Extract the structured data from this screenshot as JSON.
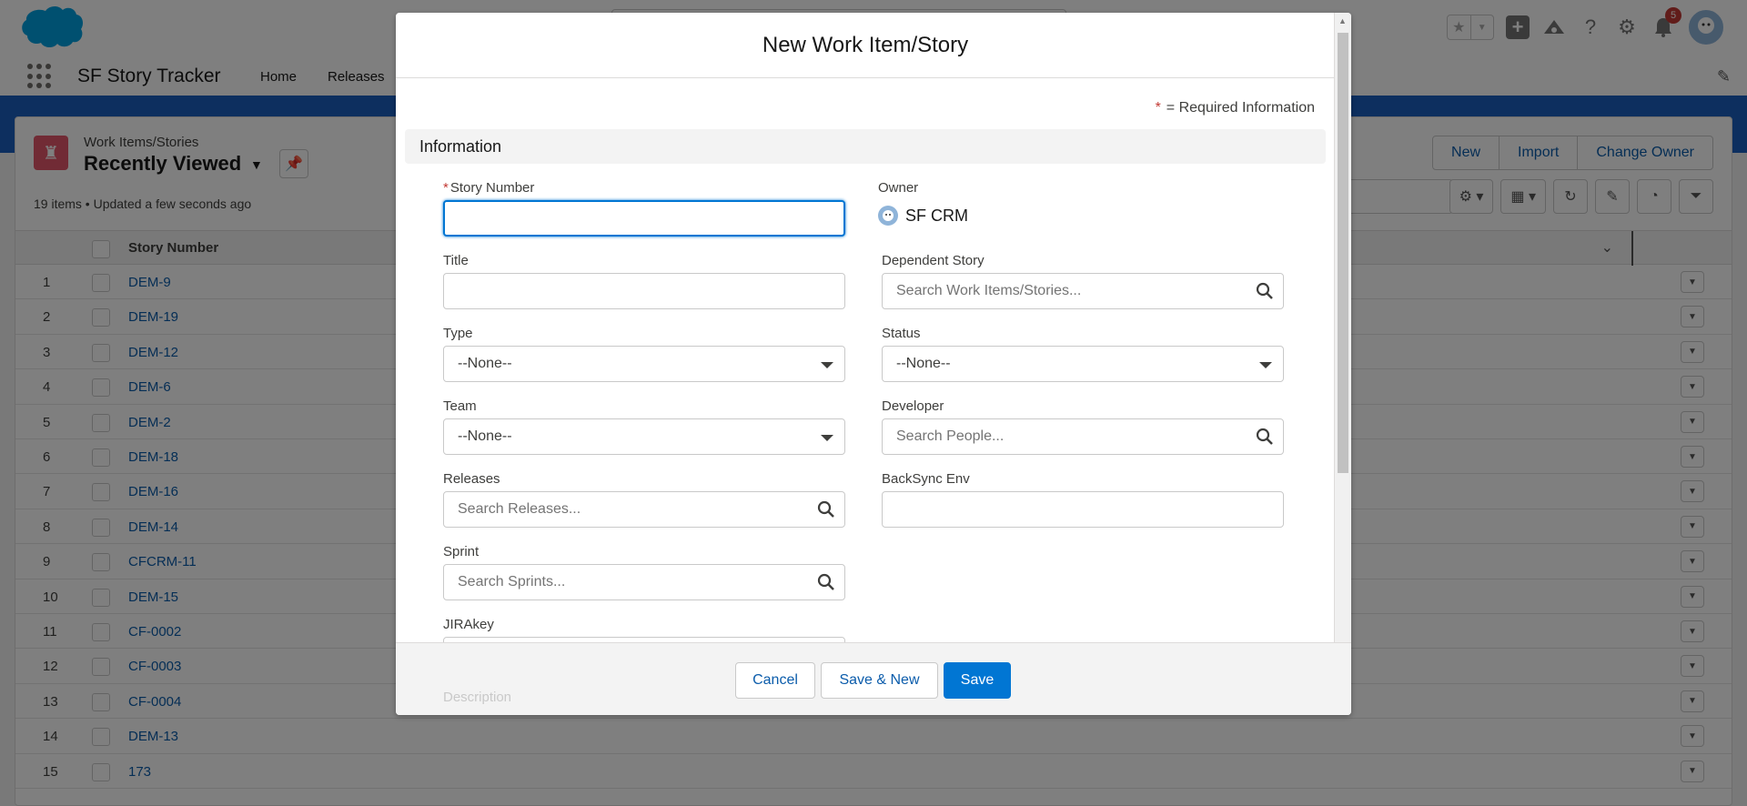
{
  "global_header": {
    "notification_count": "5"
  },
  "nav": {
    "app_name": "SF Story Tracker",
    "items": [
      "Home",
      "Releases"
    ]
  },
  "list": {
    "object_label": "Work Items/Stories",
    "view_name": "Recently Viewed",
    "meta": "19 items • Updated a few seconds ago",
    "buttons": [
      "New",
      "Import",
      "Change Owner"
    ],
    "column_header": "Story Number",
    "rows": [
      {
        "num": "1",
        "story": "DEM-9"
      },
      {
        "num": "2",
        "story": "DEM-19"
      },
      {
        "num": "3",
        "story": "DEM-12"
      },
      {
        "num": "4",
        "story": "DEM-6"
      },
      {
        "num": "5",
        "story": "DEM-2"
      },
      {
        "num": "6",
        "story": "DEM-18"
      },
      {
        "num": "7",
        "story": "DEM-16"
      },
      {
        "num": "8",
        "story": "DEM-14"
      },
      {
        "num": "9",
        "story": "CFCRM-11"
      },
      {
        "num": "10",
        "story": "DEM-15"
      },
      {
        "num": "11",
        "story": "CF-0002"
      },
      {
        "num": "12",
        "story": "CF-0003"
      },
      {
        "num": "13",
        "story": "CF-0004"
      },
      {
        "num": "14",
        "story": "DEM-13"
      },
      {
        "num": "15",
        "story": "173"
      }
    ]
  },
  "modal": {
    "title": "New Work Item/Story",
    "required_note": "= Required Information",
    "section_title": "Information",
    "fields": {
      "story_number": {
        "label": "Story Number",
        "value": ""
      },
      "owner": {
        "label": "Owner",
        "value": "SF CRM"
      },
      "title": {
        "label": "Title",
        "value": ""
      },
      "dependent_story": {
        "label": "Dependent Story",
        "placeholder": "Search Work Items/Stories..."
      },
      "type": {
        "label": "Type",
        "value": "--None--"
      },
      "status": {
        "label": "Status",
        "value": "--None--"
      },
      "team": {
        "label": "Team",
        "value": "--None--"
      },
      "developer": {
        "label": "Developer",
        "placeholder": "Search People..."
      },
      "releases": {
        "label": "Releases",
        "placeholder": "Search Releases..."
      },
      "backsync_env": {
        "label": "BackSync Env",
        "value": ""
      },
      "sprint": {
        "label": "Sprint",
        "placeholder": "Search Sprints..."
      },
      "jirakey": {
        "label": "JIRAkey",
        "value": ""
      },
      "description": {
        "label": "Description"
      }
    },
    "footer": {
      "cancel": "Cancel",
      "save_new": "Save & New",
      "save": "Save"
    }
  },
  "colors": {
    "brand_blue": "#0176d3",
    "link_blue": "#0b5cab",
    "required_red": "#c23934",
    "object_icon": "#e3566a"
  }
}
